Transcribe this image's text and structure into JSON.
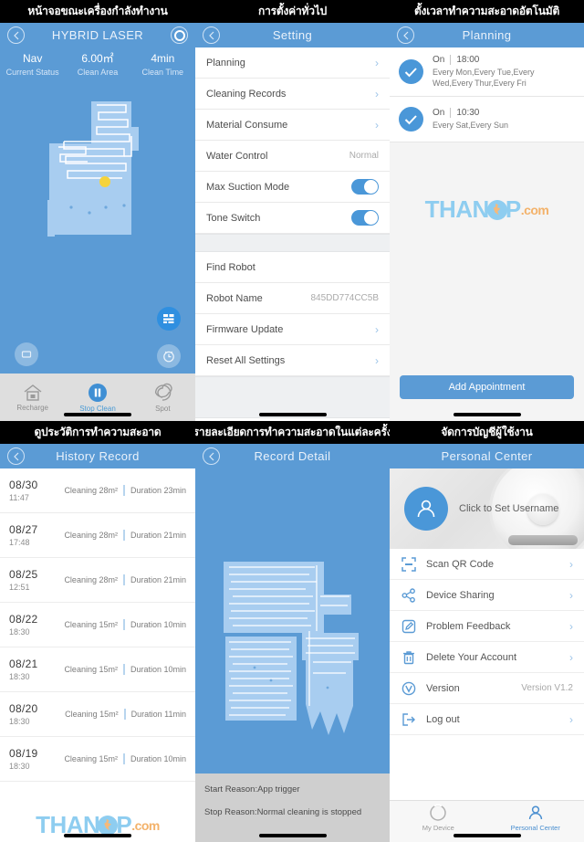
{
  "panels": [
    {
      "caption": "หน้าจอขณะเครื่องกำลังทำงาน",
      "nav_title": "HYBRID LASER",
      "back_icon": "chevron-left-icon",
      "right_icon": "gear-icon",
      "status": [
        {
          "value": "Nav",
          "label": "Current Status"
        },
        {
          "value": "6.00㎡",
          "label": "Clean Area"
        },
        {
          "value": "4min",
          "label": "Clean Time"
        }
      ],
      "fabs": [
        {
          "name": "fullscreen-icon",
          "state": "dim"
        },
        {
          "name": "direction-pad-icon",
          "state": "dim"
        },
        {
          "name": "zone-map-icon",
          "state": "blue"
        },
        {
          "name": "clock-icon",
          "state": "dim"
        },
        {
          "name": "battery-icon",
          "state": "blue"
        }
      ],
      "toolbar": [
        {
          "label": "Recharge",
          "icon": "home-icon",
          "active": false
        },
        {
          "label": "Stop Clean",
          "icon": "pause-icon",
          "active": true
        },
        {
          "label": "Spot",
          "icon": "spiral-icon",
          "active": false
        }
      ]
    },
    {
      "caption": "การตั้งค่าทั่วไป",
      "nav_title": "Setting",
      "rows_group1": [
        {
          "label": "Planning",
          "type": "chevron"
        },
        {
          "label": "Cleaning Records",
          "type": "chevron"
        },
        {
          "label": "Material Consume",
          "type": "chevron"
        },
        {
          "label": "Water Control",
          "type": "value",
          "value": "Normal"
        },
        {
          "label": "Max Suction Mode",
          "type": "toggle",
          "on": true
        },
        {
          "label": "Tone Switch",
          "type": "toggle",
          "on": true
        }
      ],
      "rows_group2": [
        {
          "label": "Find Robot",
          "type": "plain"
        },
        {
          "label": "Robot Name",
          "type": "value",
          "value": "845DD774CC5B"
        },
        {
          "label": "Firmware Update",
          "type": "chevron"
        },
        {
          "label": "Reset All Settings",
          "type": "chevron"
        }
      ]
    },
    {
      "caption": "ตั้งเวลาทำความสะอาดอัตโนมัติ",
      "nav_title": "Planning",
      "appointments": [
        {
          "state": "On",
          "time": "18:00",
          "days": "Every Mon,Every Tue,Every Wed,Every Thur,Every Fri",
          "checked": true
        },
        {
          "state": "On",
          "time": "10:30",
          "days": "Every Sat,Every Sun",
          "checked": true
        }
      ],
      "add_button": "Add Appointment"
    },
    {
      "caption": "ดูประวัติการทำความสะอาด",
      "nav_title": "History Record",
      "records": [
        {
          "date": "08/30",
          "time": "11:47",
          "area": "Cleaning 28m²",
          "duration": "Duration 23min"
        },
        {
          "date": "08/27",
          "time": "17:48",
          "area": "Cleaning 28m²",
          "duration": "Duration 21min"
        },
        {
          "date": "08/25",
          "time": "12:51",
          "area": "Cleaning 28m²",
          "duration": "Duration 21min"
        },
        {
          "date": "08/22",
          "time": "18:30",
          "area": "Cleaning 15m²",
          "duration": "Duration 10min"
        },
        {
          "date": "08/21",
          "time": "18:30",
          "area": "Cleaning 15m²",
          "duration": "Duration 10min"
        },
        {
          "date": "08/20",
          "time": "18:30",
          "area": "Cleaning 15m²",
          "duration": "Duration 11min"
        },
        {
          "date": "08/19",
          "time": "18:30",
          "area": "Cleaning 15m²",
          "duration": "Duration 10min"
        }
      ]
    },
    {
      "caption": "รายละเอียดการทำความสะอาดในแต่ละครั้ง",
      "nav_title": "Record Detail",
      "start_reason": "Start Reason:App trigger",
      "stop_reason": "Stop Reason:Normal cleaning is stopped"
    },
    {
      "caption": "จัดการบัญชีผู้ใช้งาน",
      "nav_title": "Personal Center",
      "username_prompt": "Click to Set Username",
      "menu": [
        {
          "label": "Scan QR Code",
          "icon": "qr-scan-icon",
          "type": "chevron"
        },
        {
          "label": "Device Sharing",
          "icon": "share-icon",
          "type": "chevron"
        },
        {
          "label": "Problem Feedback",
          "icon": "edit-icon",
          "type": "chevron"
        },
        {
          "label": "Delete Your Account",
          "icon": "trash-icon",
          "type": "chevron"
        },
        {
          "label": "Version",
          "icon": "version-icon",
          "type": "value",
          "value": "Version V1.2"
        },
        {
          "label": "Log out",
          "icon": "logout-icon",
          "type": "chevron"
        }
      ],
      "tabs": [
        {
          "label": "My Device",
          "icon": "device-circle-icon",
          "active": false
        },
        {
          "label": "Personal Center",
          "icon": "person-icon",
          "active": true
        }
      ]
    }
  ],
  "watermark": {
    "text1": "THAN",
    "text2": "P",
    "text3": ".com"
  },
  "colors": {
    "accent": "#5b9bd5",
    "toggle_on": "#4a97d8",
    "map_bg": "#5b9bd5",
    "map_clean": "#a8cdf0",
    "robot_dot": "#f5d33c"
  }
}
